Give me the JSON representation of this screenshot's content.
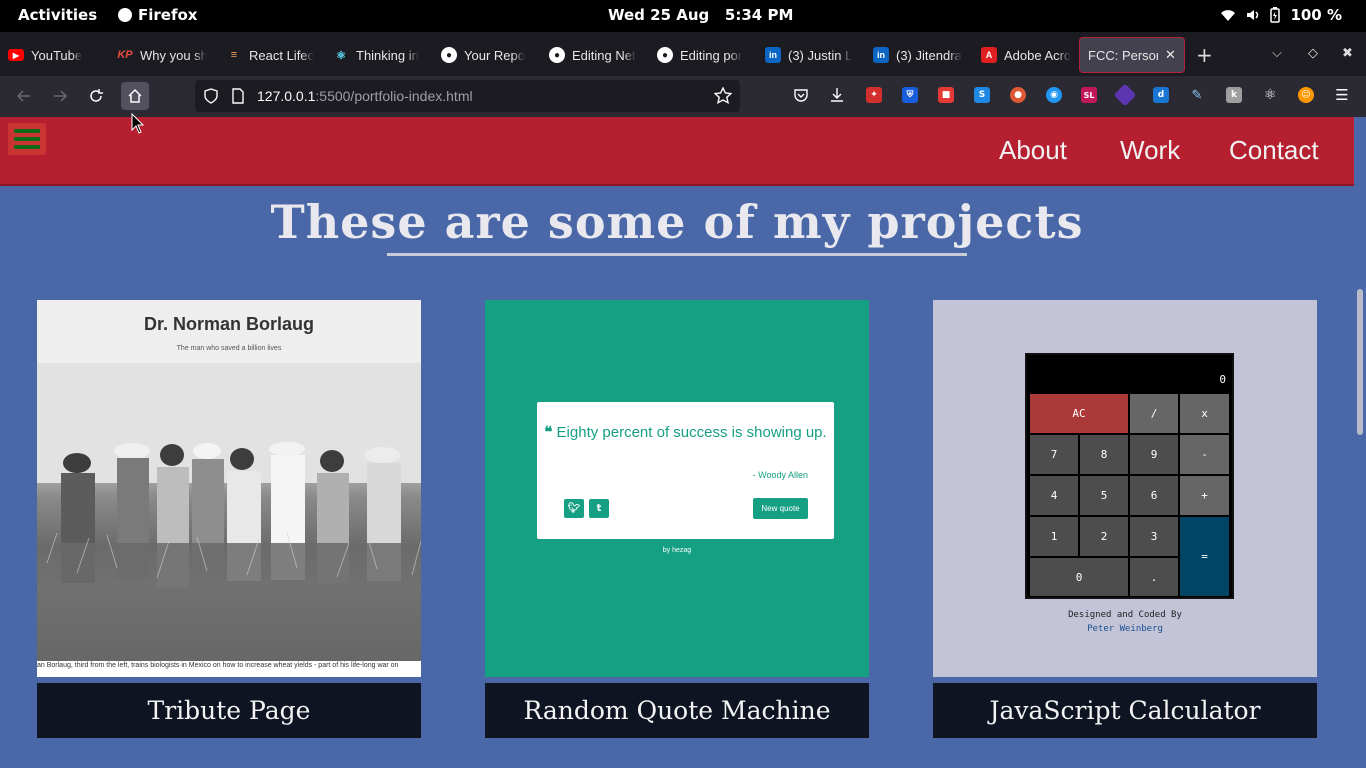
{
  "system": {
    "activities": "Activities",
    "app_name": "Firefox",
    "clock": "Wed 25 Aug   5:34 PM",
    "battery": "100 %"
  },
  "tabs": [
    {
      "label": "YouTube",
      "icon": "youtube-icon",
      "color": "#ff0000"
    },
    {
      "label": "Why you sh",
      "icon": "kp-icon",
      "color": "#e84c3d"
    },
    {
      "label": "React Lifec",
      "icon": "article-icon",
      "color": "#f0a35b"
    },
    {
      "label": "Thinking in",
      "icon": "react-icon",
      "color": "#61dafb"
    },
    {
      "label": "Your Repo",
      "icon": "github-icon",
      "color": "#ffffff"
    },
    {
      "label": "Editing Net",
      "icon": "github-icon",
      "color": "#ffffff"
    },
    {
      "label": "Editing por",
      "icon": "github-icon",
      "color": "#ffffff"
    },
    {
      "label": "(3) Justin L",
      "icon": "linkedin-icon",
      "color": "#0a66c2"
    },
    {
      "label": "(3) Jitendra",
      "icon": "linkedin-icon",
      "color": "#0a66c2"
    },
    {
      "label": "Adobe Acro",
      "icon": "pdf-icon",
      "color": "#e02020"
    },
    {
      "label": "FCC: Person",
      "icon": "none",
      "color": "#ffffff",
      "active": true
    }
  ],
  "url": {
    "host": "127.0.0.1",
    "rest": ":5500/portfolio-index.html"
  },
  "site": {
    "nav": {
      "about": "About",
      "work": "Work",
      "contact": "Contact"
    },
    "section_title": "These are some of my projects",
    "projects": [
      {
        "caption": "Tribute Page",
        "thumb": {
          "title": "Dr. Norman Borlaug",
          "subtitle": "The man who saved a billion lives",
          "photo_caption": "an Borlaug, third from the left, trains biologists in Mexico on how to increase wheat yields - part of his life-long war on"
        }
      },
      {
        "caption": "Random Quote Machine",
        "thumb": {
          "quote": "Eighty percent of success is showing up.",
          "author": "- Woody Allen",
          "twitter": "t",
          "tumblr": "t",
          "new_quote": "New quote",
          "by": "by hezag"
        }
      },
      {
        "caption": "JavaScript Calculator",
        "thumb": {
          "display": "0",
          "keys": [
            "AC",
            "/",
            "x",
            "7",
            "8",
            "9",
            "-",
            "4",
            "5",
            "6",
            "+",
            "1",
            "2",
            "3",
            "=",
            "0",
            "."
          ],
          "credit_line": "Designed and Coded By",
          "credit_name": "Peter Weinberg"
        }
      }
    ]
  },
  "colors": {
    "site_bg": "#4a67a8",
    "nav_bg": "#b51f30",
    "quote_green": "#16a083",
    "calc_bg": "#c3c4d8",
    "caption_bg": "#0f1422"
  }
}
